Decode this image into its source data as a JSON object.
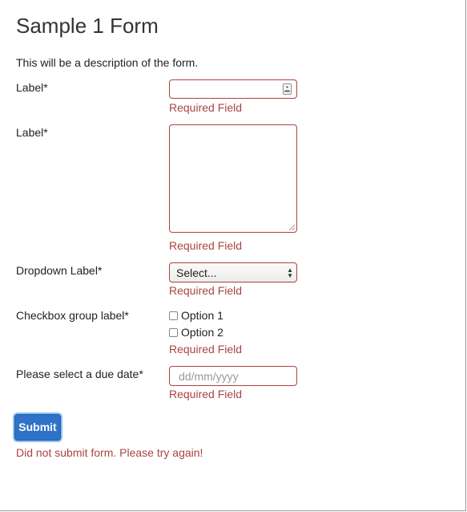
{
  "form": {
    "title": "Sample 1 Form",
    "description": "This will be a description of the form.",
    "fields": {
      "text": {
        "label": "Label*",
        "value": "",
        "error": "Required Field",
        "icon": "contact-card-icon"
      },
      "textarea": {
        "label": "Label*",
        "value": "",
        "error": "Required Field"
      },
      "dropdown": {
        "label": "Dropdown Label*",
        "selected": "Select...",
        "error": "Required Field"
      },
      "checkboxes": {
        "label": "Checkbox group label*",
        "options": [
          {
            "label": "Option 1",
            "checked": false
          },
          {
            "label": "Option 2",
            "checked": false
          }
        ],
        "error": "Required Field"
      },
      "date": {
        "label": "Please select a due date*",
        "placeholder": "dd/mm/yyyy",
        "error": "Required Field"
      }
    },
    "submit_label": "Submit",
    "submit_error": "Did not submit form. Please try again!"
  },
  "colors": {
    "error": "#a94442",
    "primary_button": "#2f72c8",
    "focus_ring": "#8ec0f5"
  }
}
